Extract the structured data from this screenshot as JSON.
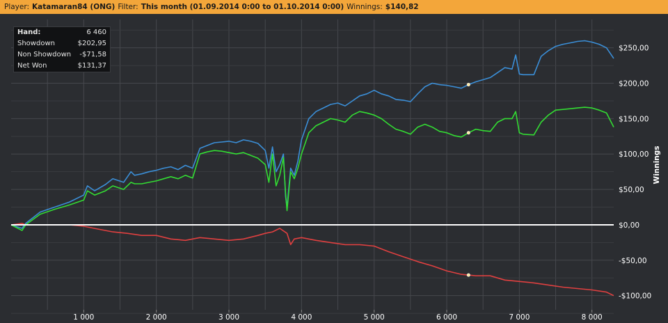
{
  "header": {
    "player_label": "Player:",
    "player": "Katamaran84 (ONG)",
    "filter_label": "Filter:",
    "filter": "This month (01.09.2014 0:00 to 01.10.2014 0:00)",
    "winnings_label": "Winnings:",
    "winnings": "$140,82"
  },
  "stats": {
    "hand_label": "Hand:",
    "hand": "6 460",
    "showdown_label": "Showdown",
    "showdown": "$202,95",
    "non_showdown_label": "Non Showdown",
    "non_showdown": "-$71,58",
    "net_won_label": "Net Won",
    "net_won": "$131,37"
  },
  "colors": {
    "header_bg": "#f3a63a",
    "plot_bg": "#2b2d31",
    "grid": "#46484d",
    "showdown": "#3b8fd8",
    "net_won": "#33dd33",
    "non_showdown": "#e04040",
    "zero_line": "#ffffff"
  },
  "chart_data": {
    "type": "line",
    "xlabel": "",
    "ylabel": "Winnings",
    "xlim": [
      0,
      8300
    ],
    "ylim": [
      -120,
      290
    ],
    "x_ticks": [
      1000,
      2000,
      3000,
      4000,
      5000,
      6000,
      7000,
      8000
    ],
    "x_tick_labels": [
      "1 000",
      "2 000",
      "3 000",
      "4 000",
      "5 000",
      "6 000",
      "7 000",
      "8 000"
    ],
    "y_ticks": [
      -100,
      -50,
      0,
      50,
      100,
      150,
      200,
      250
    ],
    "y_tick_labels": [
      "-$100,00",
      "-$50,00",
      "$0,00",
      "$50,00",
      "$100,00",
      "$150,00",
      "$200,00",
      "$250,00"
    ],
    "grid": true,
    "marker_x": 6300,
    "series": [
      {
        "color": "#3b8fd8",
        "x": [
          0,
          150,
          200,
          400,
          600,
          800,
          1000,
          1050,
          1150,
          1300,
          1400,
          1550,
          1650,
          1700,
          1800,
          1900,
          2000,
          2100,
          2200,
          2300,
          2400,
          2500,
          2600,
          2700,
          2800,
          2900,
          3000,
          3100,
          3200,
          3300,
          3400,
          3500,
          3550,
          3600,
          3650,
          3700,
          3750,
          3780,
          3800,
          3850,
          3900,
          3950,
          4000,
          4100,
          4200,
          4300,
          4400,
          4500,
          4600,
          4700,
          4800,
          4900,
          5000,
          5100,
          5200,
          5300,
          5400,
          5500,
          5600,
          5700,
          5800,
          5900,
          6000,
          6100,
          6200,
          6300,
          6400,
          6500,
          6600,
          6700,
          6800,
          6900,
          6950,
          7000,
          7050,
          7200,
          7300,
          7400,
          7500,
          7600,
          7700,
          7800,
          7900,
          8000,
          8100,
          8200,
          8300
        ],
        "values": [
          0,
          -5,
          2,
          18,
          25,
          32,
          42,
          55,
          48,
          57,
          65,
          60,
          75,
          70,
          72,
          75,
          77,
          80,
          82,
          78,
          84,
          80,
          108,
          112,
          116,
          117,
          118,
          116,
          120,
          118,
          115,
          105,
          80,
          110,
          75,
          85,
          100,
          40,
          25,
          80,
          70,
          90,
          120,
          150,
          160,
          165,
          170,
          172,
          168,
          175,
          182,
          185,
          190,
          185,
          182,
          177,
          176,
          174,
          185,
          195,
          200,
          198,
          197,
          195,
          193,
          198,
          202,
          205,
          208,
          215,
          222,
          220,
          240,
          213,
          212,
          212,
          238,
          246,
          252,
          255,
          257,
          259,
          260,
          258,
          255,
          250,
          235
        ]
      },
      {
        "color": "#33dd33",
        "x": [
          0,
          150,
          200,
          400,
          600,
          800,
          1000,
          1050,
          1150,
          1300,
          1400,
          1550,
          1650,
          1700,
          1800,
          1900,
          2000,
          2100,
          2200,
          2300,
          2400,
          2500,
          2600,
          2700,
          2800,
          2900,
          3000,
          3100,
          3200,
          3300,
          3400,
          3500,
          3550,
          3600,
          3650,
          3700,
          3750,
          3780,
          3800,
          3850,
          3900,
          3950,
          4000,
          4100,
          4200,
          4300,
          4400,
          4500,
          4600,
          4700,
          4800,
          4900,
          5000,
          5100,
          5200,
          5300,
          5400,
          5500,
          5600,
          5700,
          5800,
          5900,
          6000,
          6100,
          6200,
          6300,
          6400,
          6500,
          6600,
          6700,
          6800,
          6900,
          6950,
          7000,
          7050,
          7200,
          7300,
          7400,
          7500,
          7600,
          7700,
          7800,
          7900,
          8000,
          8100,
          8200,
          8300
        ],
        "values": [
          0,
          -8,
          0,
          15,
          22,
          28,
          35,
          48,
          42,
          48,
          55,
          50,
          60,
          58,
          58,
          60,
          62,
          65,
          68,
          65,
          70,
          66,
          100,
          103,
          105,
          104,
          102,
          100,
          102,
          98,
          94,
          85,
          60,
          100,
          55,
          70,
          95,
          45,
          20,
          75,
          65,
          80,
          100,
          130,
          140,
          145,
          150,
          148,
          145,
          155,
          160,
          158,
          155,
          150,
          142,
          135,
          132,
          128,
          138,
          142,
          138,
          132,
          130,
          126,
          124,
          130,
          135,
          133,
          132,
          145,
          150,
          150,
          160,
          130,
          128,
          127,
          145,
          155,
          162,
          163,
          164,
          165,
          166,
          165,
          162,
          158,
          138
        ]
      },
      {
        "color": "#e04040",
        "x": [
          0,
          150,
          200,
          400,
          600,
          800,
          1000,
          1200,
          1400,
          1600,
          1800,
          2000,
          2200,
          2400,
          2600,
          2800,
          3000,
          3200,
          3400,
          3500,
          3600,
          3700,
          3800,
          3850,
          3900,
          4000,
          4200,
          4400,
          4600,
          4800,
          5000,
          5200,
          5400,
          5600,
          5800,
          6000,
          6200,
          6400,
          6600,
          6800,
          7000,
          7200,
          7400,
          7600,
          7800,
          8000,
          8200,
          8300
        ],
        "values": [
          0,
          2,
          0,
          0,
          0,
          0,
          -2,
          -6,
          -10,
          -12,
          -15,
          -15,
          -20,
          -22,
          -18,
          -20,
          -22,
          -20,
          -15,
          -12,
          -10,
          -5,
          -12,
          -28,
          -20,
          -18,
          -22,
          -25,
          -28,
          -28,
          -30,
          -38,
          -45,
          -52,
          -58,
          -65,
          -70,
          -72,
          -72,
          -78,
          -80,
          -82,
          -85,
          -88,
          -90,
          -92,
          -95,
          -100
        ]
      }
    ]
  }
}
